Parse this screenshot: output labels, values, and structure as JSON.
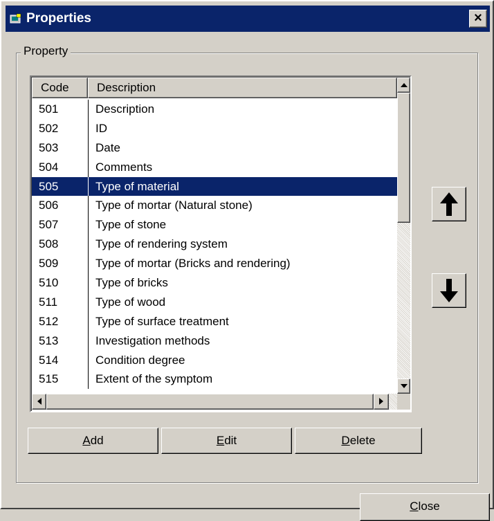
{
  "window": {
    "title": "Properties",
    "close_glyph": "×"
  },
  "group": {
    "label": "Property"
  },
  "list": {
    "columns": [
      "Code",
      "Description"
    ],
    "rows": [
      {
        "code": "501",
        "desc": "Description"
      },
      {
        "code": "502",
        "desc": "ID"
      },
      {
        "code": "503",
        "desc": "Date"
      },
      {
        "code": "504",
        "desc": "Comments"
      },
      {
        "code": "505",
        "desc": "Type of material"
      },
      {
        "code": "506",
        "desc": "Type of mortar (Natural stone)"
      },
      {
        "code": "507",
        "desc": "Type of stone"
      },
      {
        "code": "508",
        "desc": "Type of rendering system"
      },
      {
        "code": "509",
        "desc": "Type of mortar (Bricks and rendering)"
      },
      {
        "code": "510",
        "desc": "Type of bricks"
      },
      {
        "code": "511",
        "desc": "Type of wood"
      },
      {
        "code": "512",
        "desc": "Type of surface treatment"
      },
      {
        "code": "513",
        "desc": "Investigation methods"
      },
      {
        "code": "514",
        "desc": "Condition degree"
      },
      {
        "code": "515",
        "desc": "Extent of the symptom"
      }
    ],
    "selected_code": "505"
  },
  "buttons": {
    "add": {
      "pre": "",
      "key": "A",
      "post": "dd"
    },
    "edit": {
      "pre": "",
      "key": "E",
      "post": "dit"
    },
    "delete": {
      "pre": "",
      "key": "D",
      "post": "elete"
    },
    "close": {
      "pre": "",
      "key": "C",
      "post": "lose"
    }
  },
  "icons": {
    "move_up": "arrow-up-icon",
    "move_down": "arrow-down-icon"
  },
  "colors": {
    "titlebar": "#0a246a",
    "selection": "#0a246a",
    "face": "#d4d0c8"
  }
}
